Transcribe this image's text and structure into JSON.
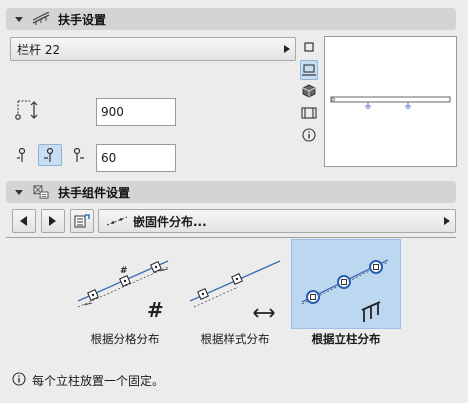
{
  "railing_settings": {
    "title": "扶手设置",
    "railing_type": "栏杆 22",
    "height_value": "900",
    "offset_value": "60"
  },
  "component_settings": {
    "title": "扶手组件设置",
    "distribution_dropdown": "嵌固件分布...",
    "options": [
      {
        "label": "根据分格分布",
        "selected": false
      },
      {
        "label": "根据样式分布",
        "selected": false
      },
      {
        "label": "根据立柱分布",
        "selected": true
      }
    ],
    "info_text": "每个立柱放置一个固定。"
  },
  "icons": {
    "section_toggle": "collapse-triangle-icon",
    "railing": "railing-icon",
    "component": "component-icon",
    "info": "info-icon"
  },
  "colors": {
    "accent": "#3b6fb6",
    "selection": "#bcd7f0",
    "header_bg": "#d4d4d4"
  }
}
